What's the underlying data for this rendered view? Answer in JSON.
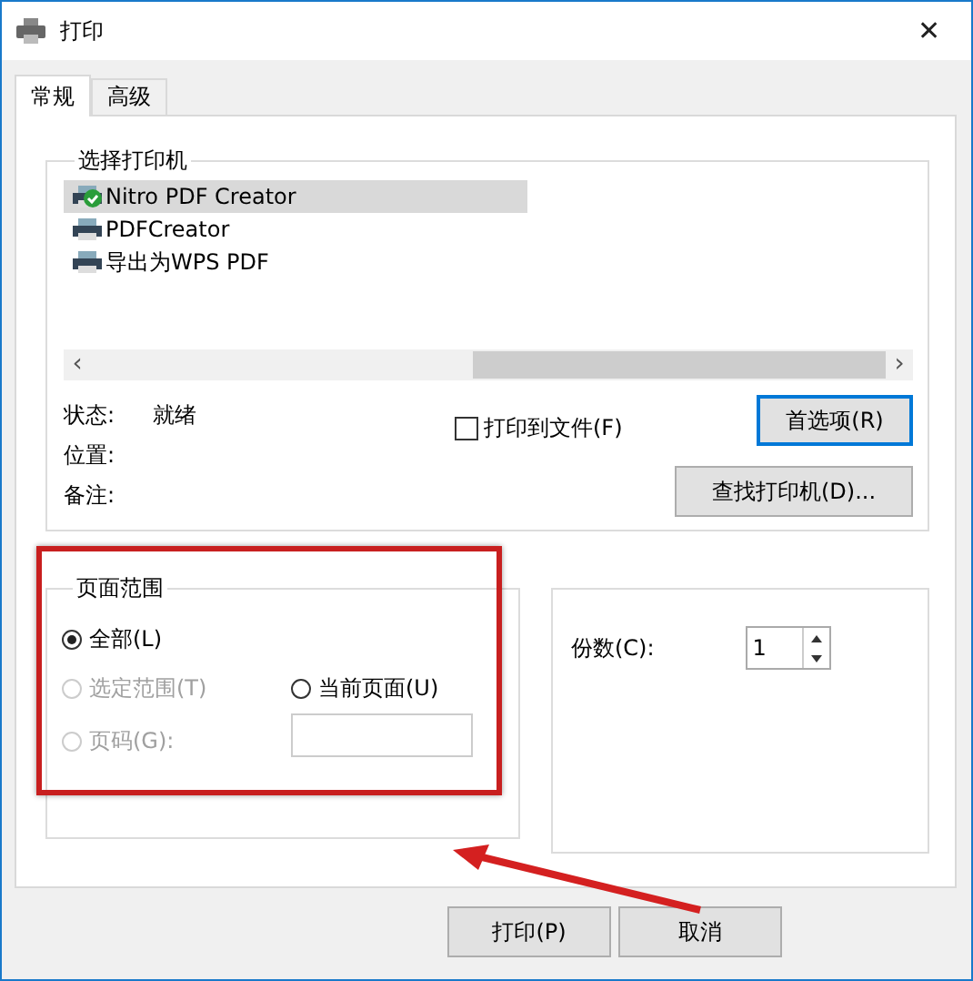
{
  "window": {
    "title": "打印",
    "close": "✕"
  },
  "tabs": [
    {
      "label": "常规",
      "selected": true
    },
    {
      "label": "高级",
      "selected": false
    }
  ],
  "printer_group": {
    "title": "选择打印机",
    "printers": [
      {
        "name": "Nitro PDF Creator",
        "selected": true,
        "default": true
      },
      {
        "name": "PDFCreator",
        "selected": false,
        "default": false
      },
      {
        "name": "导出为WPS PDF",
        "selected": false,
        "default": false
      }
    ],
    "scrollbar": {
      "left": "‹",
      "right": "›"
    },
    "info": [
      {
        "label": "状态:",
        "value": "就绪"
      },
      {
        "label": "位置:"
      },
      {
        "label": "备注:"
      }
    ],
    "print_to_file": {
      "label": "打印到文件(F)",
      "checked": false
    },
    "preferences_button": "首选项(R)",
    "find_button": "查找打印机(D)..."
  },
  "page_range": {
    "title": "页面范围",
    "options": [
      {
        "label": "全部(L)",
        "checked": true,
        "disabled": false
      },
      {
        "label": "选定范围(T)",
        "checked": false,
        "disabled": true
      },
      {
        "label": "当前页面(U)",
        "checked": false,
        "disabled": false
      },
      {
        "label": "页码(G):",
        "checked": false,
        "disabled": true
      }
    ]
  },
  "copies": {
    "label": "份数(C):",
    "value": "1"
  },
  "buttons": [
    "打印(P)",
    "取消"
  ],
  "annotations": {
    "highlight_box": true,
    "arrow": true
  }
}
